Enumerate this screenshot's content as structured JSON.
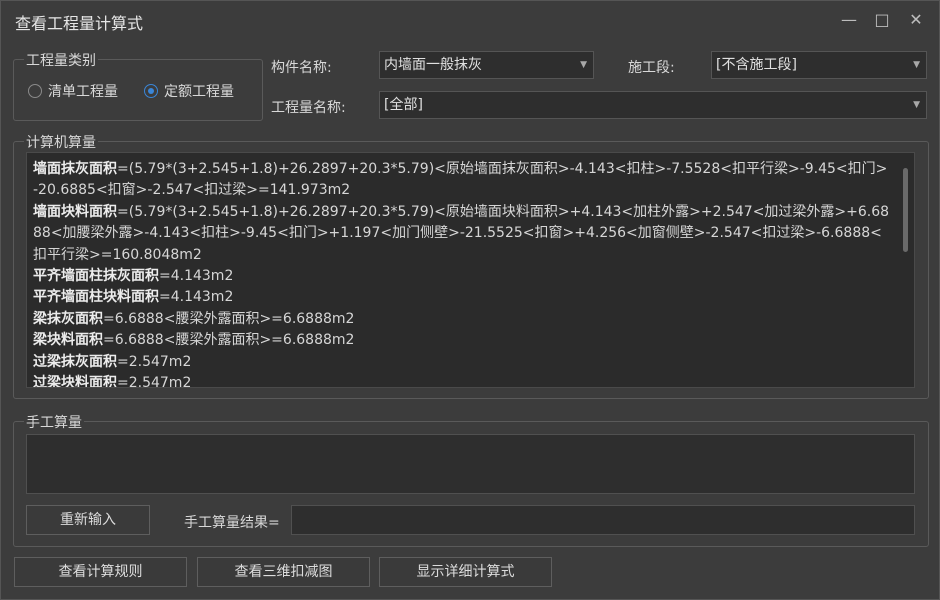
{
  "window": {
    "title": "查看工程量计算式",
    "minimize_icon": "minimize-icon",
    "maximize_icon": "maximize-icon",
    "close_icon": "close-icon"
  },
  "quantity_type": {
    "legend": "工程量类别",
    "options": [
      {
        "label": "清单工程量",
        "selected": false
      },
      {
        "label": "定额工程量",
        "selected": true
      }
    ]
  },
  "filters": {
    "component_label": "构件名称:",
    "component_value": "内墙面一般抹灰",
    "stage_label": "施工段:",
    "stage_value": "[不含施工段]",
    "quantity_name_label": "工程量名称:",
    "quantity_name_value": "[全部]"
  },
  "computer_calc": {
    "legend": "计算机算量",
    "lines": [
      {
        "name": "墙面抹灰面积",
        "expr": "=(5.79*(3+2.545+1.8)+26.2897+20.3*5.79)<原始墙面抹灰面积>-4.143<扣柱>-7.5528<扣平行梁>-9.45<扣门>-20.6885<扣窗>-2.547<扣过梁>=141.973m2"
      },
      {
        "name": "墙面块料面积",
        "expr": "=(5.79*(3+2.545+1.8)+26.2897+20.3*5.79)<原始墙面块料面积>+4.143<加柱外露>+2.547<加过梁外露>+6.6888<加腰梁外露>-4.143<扣柱>-9.45<扣门>+1.197<加门侧壁>-21.5525<扣窗>+4.256<加窗侧壁>-2.547<扣过梁>-6.6888<扣平行梁>=160.8048m2"
      },
      {
        "name": "平齐墙面柱抹灰面积",
        "expr": "=4.143m2"
      },
      {
        "name": "平齐墙面柱块料面积",
        "expr": "=4.143m2"
      },
      {
        "name": "梁抹灰面积",
        "expr": "=6.6888<腰梁外露面积>=6.6888m2"
      },
      {
        "name": "梁块料面积",
        "expr": "=6.6888<腰梁外露面积>=6.6888m2"
      },
      {
        "name": "过梁抹灰面积",
        "expr": "=2.547m2"
      },
      {
        "name": "过梁块料面积",
        "expr": "=2.547m2"
      }
    ]
  },
  "manual_calc": {
    "legend": "手工算量",
    "input_value": "",
    "reenter_button": "重新输入",
    "result_label": "手工算量结果=",
    "result_value": ""
  },
  "footer": {
    "view_rules": "查看计算规则",
    "view_3d": "查看三维扣减图",
    "show_detail": "显示详细计算式"
  }
}
